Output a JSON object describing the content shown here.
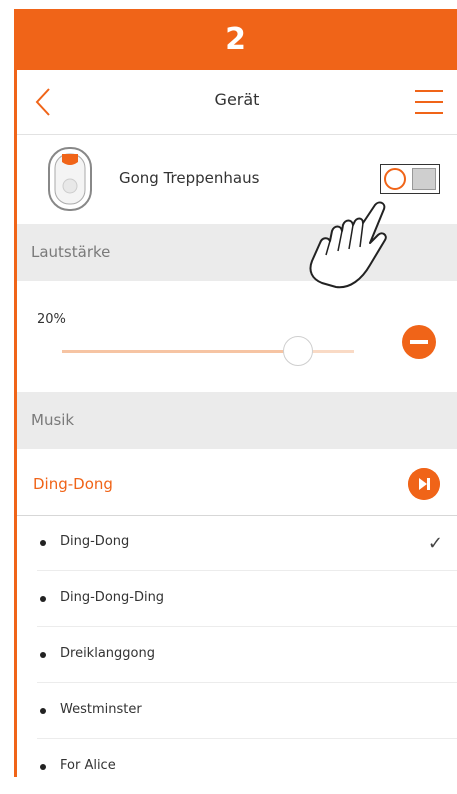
{
  "step": {
    "number": "2"
  },
  "header": {
    "title": "Gerät"
  },
  "device": {
    "name": "Gong Treppenhaus",
    "toggle_state": "on"
  },
  "volume": {
    "section_label": "Lautstärke",
    "value_label": "20%",
    "value": 20
  },
  "music": {
    "section_label": "Musik",
    "selected": "Ding-Dong",
    "options": [
      {
        "label": "Ding-Dong",
        "checked": true
      },
      {
        "label": "Ding-Dong-Ding",
        "checked": false
      },
      {
        "label": "Dreiklanggong",
        "checked": false
      },
      {
        "label": "Westminster",
        "checked": false
      },
      {
        "label": "For Alice",
        "checked": false
      }
    ]
  },
  "icons": {
    "back": "chevron-left-icon",
    "menu": "hamburger-menu-icon",
    "device": "gong-device-icon",
    "decrease": "minus-circle-icon",
    "play": "play-next-icon",
    "hand": "hand-pointer-icon"
  },
  "colors": {
    "accent": "#f06418",
    "section_bg": "#ebebeb"
  }
}
